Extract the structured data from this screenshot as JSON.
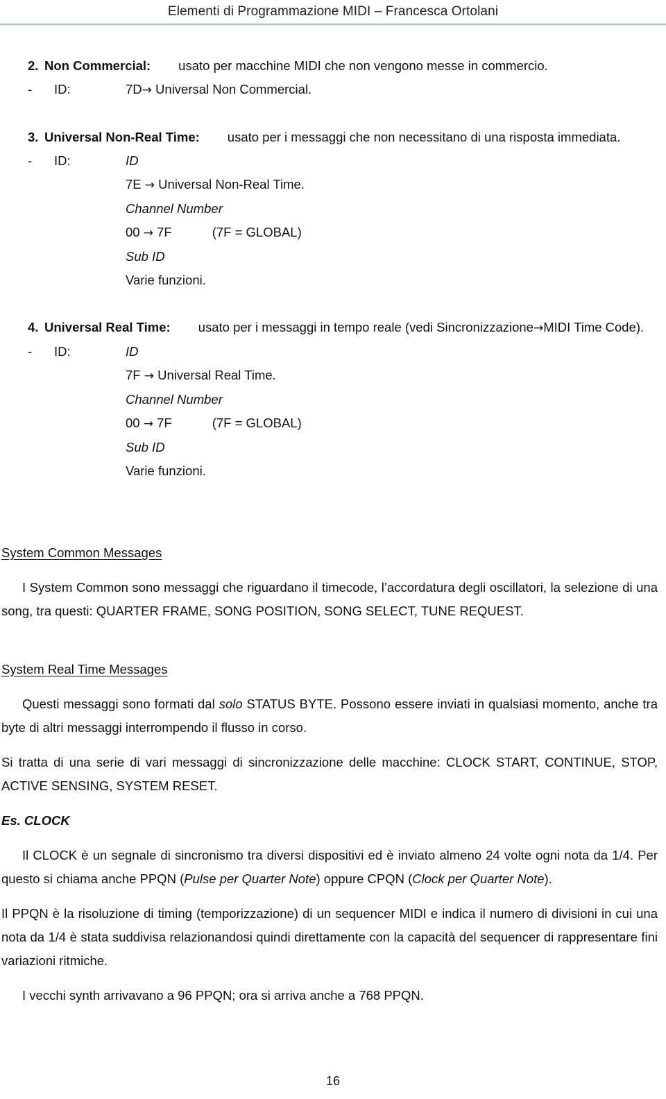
{
  "header": {
    "title": "Elementi di Programmazione MIDI – Francesca Ortolani",
    "rule_color": "#95b3c6"
  },
  "colors": {
    "text": "#111111",
    "page_background": "#ffffff",
    "rule": "#95b3c6"
  },
  "arrow_glyph": "→",
  "list_items": [
    {
      "number": "2.",
      "label": "Non Commercial:",
      "description": "usato per macchine MIDI che non vengono messe in commercio.",
      "sub": {
        "dash": "-",
        "key": "ID:",
        "value": "7D",
        "arrow_target": "Universal Non Commercial."
      }
    },
    {
      "number": "3.",
      "label": "Universal Non-Real Time:",
      "description": "usato per i messaggi che non necessitano di una risposta immediata.",
      "sub": {
        "dash": "-",
        "key": "ID:",
        "value_italic": "ID",
        "lines": [
          {
            "code": "7E",
            "target": "Universal Non-Real Time.",
            "italic": false,
            "note": ""
          },
          {
            "code": "Channel Number",
            "target": "",
            "italic": true,
            "note": ""
          },
          {
            "code": "00",
            "target": "7F",
            "italic": false,
            "note": "(7F = GLOBAL)"
          },
          {
            "code": "Sub ID",
            "target": "",
            "italic": true,
            "note": ""
          },
          {
            "code": "Varie funzioni.",
            "target": "",
            "italic": false,
            "note": ""
          }
        ]
      }
    },
    {
      "number": "4.",
      "label": "Universal Real Time:",
      "description": "usato per i messaggi in tempo reale (vedi Sincronizzazione",
      "description_tail": "MIDI Time Code).",
      "sub": {
        "dash": "-",
        "key": "ID:",
        "value_italic": "ID",
        "lines": [
          {
            "code": "7F",
            "target": "Universal Real Time.",
            "italic": false,
            "note": ""
          },
          {
            "code": "Channel Number",
            "target": "",
            "italic": true,
            "note": ""
          },
          {
            "code": "00",
            "target": "7F",
            "italic": false,
            "note": "(7F = GLOBAL)"
          },
          {
            "code": "Sub ID",
            "target": "",
            "italic": true,
            "note": ""
          },
          {
            "code": "Varie funzioni.",
            "target": "",
            "italic": false,
            "note": ""
          }
        ]
      }
    }
  ],
  "sections": [
    {
      "heading": "System Common Messages",
      "paragraph": "I System Common sono messaggi che riguardano il timecode, l’accordatura degli oscillatori, la selezione di una song, tra questi: QUARTER FRAME, SONG POSITION, SONG SELECT, TUNE REQUEST."
    },
    {
      "heading": "System Real Time Messages",
      "paragraph_1_a": "Questi messaggi sono formati dal ",
      "paragraph_1_italic": "solo",
      "paragraph_1_b": " STATUS BYTE. Possono essere inviati in qualsiasi momento, anche tra byte di altri messaggi interrompendo il flusso in corso.",
      "paragraph_2": "Si tratta di una serie di vari messaggi di sincronizzazione delle macchine: CLOCK START, CONTINUE, STOP, ACTIVE SENSING, SYSTEM RESET.",
      "example_heading": "Es. CLOCK",
      "paragraph_3_a": "Il CLOCK è un segnale di sincronismo tra diversi dispositivi ed è inviato almeno 24 volte ogni nota da 1/4. Per questo si chiama anche PPQN (",
      "paragraph_3_italic_1": "Pulse per Quarter Note",
      "paragraph_3_b": ") oppure CPQN (",
      "paragraph_3_italic_2": "Clock per Quarter Note",
      "paragraph_3_c": ").",
      "paragraph_4": "Il PPQN è la risoluzione di timing (temporizzazione) di un sequencer MIDI e indica il numero di divisioni in cui una nota da 1/4 è stata suddivisa relazionandosi quindi direttamente con la capacità del sequencer di rappresentare fini variazioni ritmiche.",
      "paragraph_5": "I vecchi synth arrivavano a 96 PPQN; ora si arriva anche a 768 PPQN."
    }
  ],
  "footer": {
    "page_number": "16"
  }
}
